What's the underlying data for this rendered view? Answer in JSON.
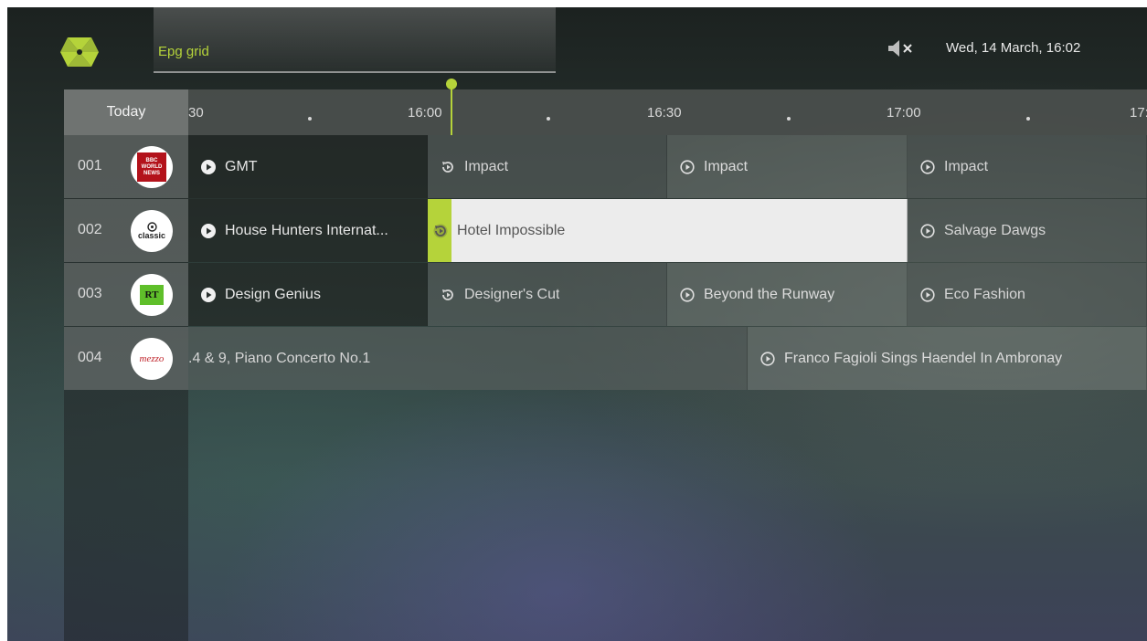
{
  "header": {
    "app_title": "Epg grid",
    "datetime": "Wed, 14 March, 16:02",
    "icons": [
      "app-logo-icon",
      "mute-icon"
    ]
  },
  "grid": {
    "day_label": "Today",
    "time_ticks": [
      "30",
      "16:00",
      "16:30",
      "17:00",
      "17:"
    ]
  },
  "channels": [
    {
      "number": "001",
      "logo_text": [
        "BBC",
        "WORLD",
        "NEWS"
      ],
      "programs": [
        {
          "title": "GMT",
          "icon": "play-icon"
        },
        {
          "title": "Impact",
          "icon": "restart-icon"
        },
        {
          "title": "Impact",
          "icon": "play-circle-icon"
        },
        {
          "title": "Impact",
          "icon": "play-circle-icon"
        }
      ]
    },
    {
      "number": "002",
      "logo_text": [
        "classic"
      ],
      "programs": [
        {
          "title": "House Hunters Internat...",
          "icon": "play-icon"
        },
        {
          "title": "Hotel Impossible",
          "icon": "restart-icon",
          "focused": true
        },
        {
          "title": "Salvage Dawgs",
          "icon": "play-circle-icon"
        }
      ]
    },
    {
      "number": "003",
      "logo_text": [
        "RT"
      ],
      "programs": [
        {
          "title": "Design Genius",
          "icon": "play-icon"
        },
        {
          "title": "Designer's Cut",
          "icon": "restart-icon"
        },
        {
          "title": "Beyond the Runway",
          "icon": "play-circle-icon"
        },
        {
          "title": "Eco Fashion",
          "icon": "play-circle-icon"
        }
      ]
    },
    {
      "number": "004",
      "logo_text": [
        "mezzo"
      ],
      "programs": [
        {
          "title": ".4 & 9, Piano Concerto No.1",
          "icon": ""
        },
        {
          "title": "Franco Fagioli Sings Haendel In Ambronay",
          "icon": "play-circle-icon"
        }
      ]
    }
  ],
  "colors": {
    "accent": "#b5d33a",
    "bbc_red": "#b3121b",
    "rt_green": "#5fbf2a",
    "mezzo_red": "#c0262d"
  }
}
